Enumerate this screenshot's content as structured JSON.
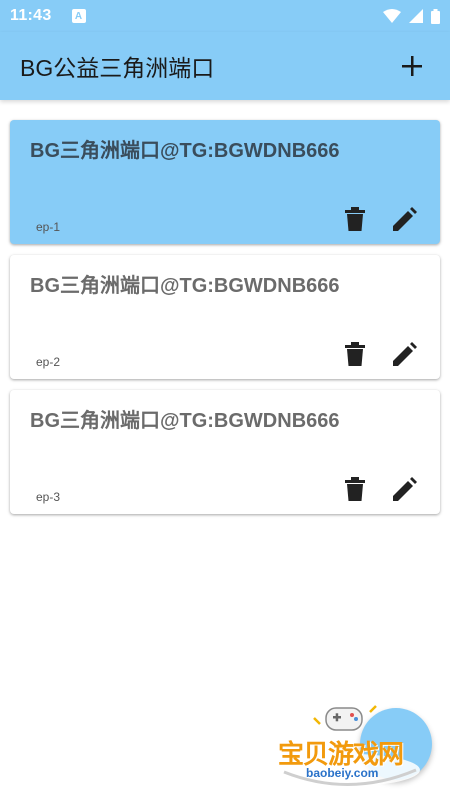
{
  "status_bar": {
    "time": "11:43",
    "notification_letter": "A"
  },
  "app_bar": {
    "title": "BG公益三角洲端口"
  },
  "cards": [
    {
      "title": "BG三角洲端口@TG:BGWDNB666",
      "subtitle": "ep-1",
      "selected": true
    },
    {
      "title": "BG三角洲端口@TG:BGWDNB666",
      "subtitle": "ep-2",
      "selected": false
    },
    {
      "title": "BG三角洲端口@TG:BGWDNB666",
      "subtitle": "ep-3",
      "selected": false
    }
  ],
  "watermark": {
    "brand": "宝贝游戏网",
    "domain": "baobeiy.com"
  },
  "colors": {
    "primary": "#87ccf7",
    "icon": "#222222"
  }
}
